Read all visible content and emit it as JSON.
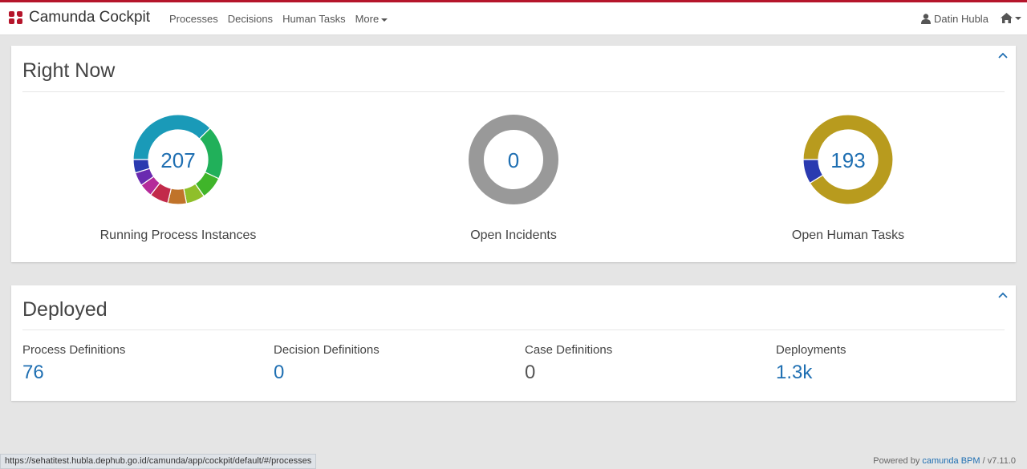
{
  "app": {
    "name": "Camunda Cockpit"
  },
  "nav": {
    "items": [
      "Processes",
      "Decisions",
      "Human Tasks"
    ],
    "more_label": "More"
  },
  "user": {
    "name": "Datin Hubla"
  },
  "right_now": {
    "title": "Right Now",
    "running": {
      "count": "207",
      "label": "Running Process Instances"
    },
    "incidents": {
      "count": "0",
      "label": "Open Incidents"
    },
    "tasks": {
      "count": "193",
      "label": "Open Human Tasks"
    }
  },
  "deployed": {
    "title": "Deployed",
    "process_definitions": {
      "label": "Process Definitions",
      "value": "76"
    },
    "decision_definitions": {
      "label": "Decision Definitions",
      "value": "0"
    },
    "case_definitions": {
      "label": "Case Definitions",
      "value": "0"
    },
    "deployments": {
      "label": "Deployments",
      "value": "1.3k"
    }
  },
  "status_url": "https://sehatitest.hubla.dephub.go.id/camunda/app/cockpit/default/#/processes",
  "footer": {
    "prefix": "Powered by",
    "brand": "camunda BPM",
    "version": "/ v7.11.0"
  },
  "colors": {
    "accent": "#b5152b",
    "link": "#1f6fb2"
  },
  "icons": {
    "logo": "camunda-logo-icon",
    "user": "user-icon",
    "home": "home-icon",
    "collapse": "chevron-up-icon"
  },
  "chart_data": [
    {
      "type": "pie",
      "title": "Running Process Instances",
      "total": 207,
      "colors": [
        "#1a9ab8",
        "#21b05a",
        "#40b52a",
        "#8fbf2a",
        "#c0732a",
        "#c22a4a",
        "#b52a9a",
        "#6a2ab0",
        "#2a3ab0"
      ],
      "values": [
        78,
        40,
        17,
        14,
        14,
        14,
        10,
        10,
        10
      ]
    },
    {
      "type": "pie",
      "title": "Open Incidents",
      "total": 0,
      "colors": [
        "#999999"
      ],
      "values": [
        1
      ]
    },
    {
      "type": "pie",
      "title": "Open Human Tasks",
      "total": 193,
      "colors": [
        "#b89b1e",
        "#2a3ab0"
      ],
      "values": [
        176,
        17
      ]
    }
  ]
}
